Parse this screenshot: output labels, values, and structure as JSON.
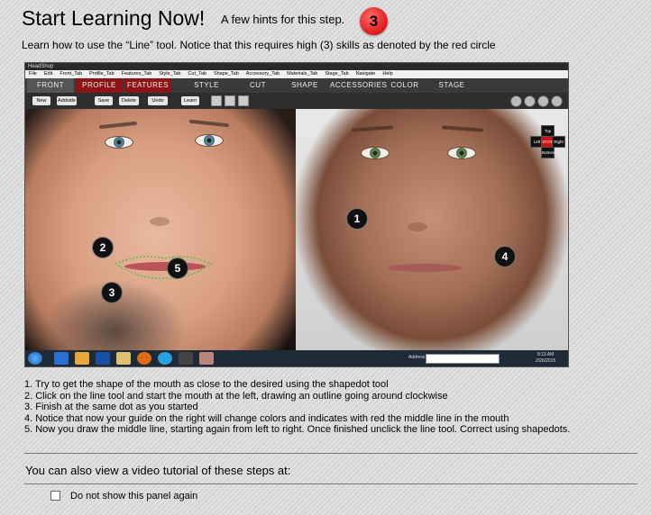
{
  "header": {
    "title": "Start Learning Now!",
    "subtitle": "A few hints for this step.",
    "skill_level": "3",
    "intro": "Learn how to use the “Line” tool. Notice that this requires high (3) skills as denoted by the red circle"
  },
  "screenshot": {
    "window_title": "HeadShop",
    "menu": [
      "File",
      "Edit",
      "Front_Tab",
      "Profile_Tab",
      "Features_Tab",
      "Style_Tab",
      "Cut_Tab",
      "Shape_Tab",
      "Accessory_Tab",
      "Materials_Tab",
      "Stage_Tab",
      "Navigate",
      "Help"
    ],
    "tabs": [
      "FRONT",
      "PROFILE",
      "FEATURES",
      "STYLE",
      "CUT",
      "SHAPE",
      "ACCESSORIES",
      "COLOR",
      "STAGE"
    ],
    "toolbar": [
      "New",
      "Addside",
      "Save",
      "Delete",
      "Undo",
      "Learn"
    ],
    "arrows": {
      "top": "Top",
      "left": "Left",
      "stop": "STOP",
      "right": "Right",
      "bottom": "Bottom"
    },
    "markers": [
      "1",
      "2",
      "3",
      "4",
      "5"
    ],
    "taskbar": {
      "address_label": "Address",
      "time": "8:13 AM",
      "date": "2/26/2015"
    }
  },
  "steps": [
    "1. Try to get the shape of the mouth as close to the desired using the shapedot tool",
    "2. Click on the line tool and start the mouth at the left, drawing an outline going around clockwise",
    "3. Finish at the same dot as you started",
    "4. Notice that now your guide on the right will change colors and indicates with red the middle line in the mouth",
    "5. Now you draw the middle line, starting again from left to right. Once finished unclick the line tool.  Correct using shapedots."
  ],
  "video_text": "You can also view a video tutorial of these steps at:",
  "checkbox_label": "Do not show this panel again"
}
